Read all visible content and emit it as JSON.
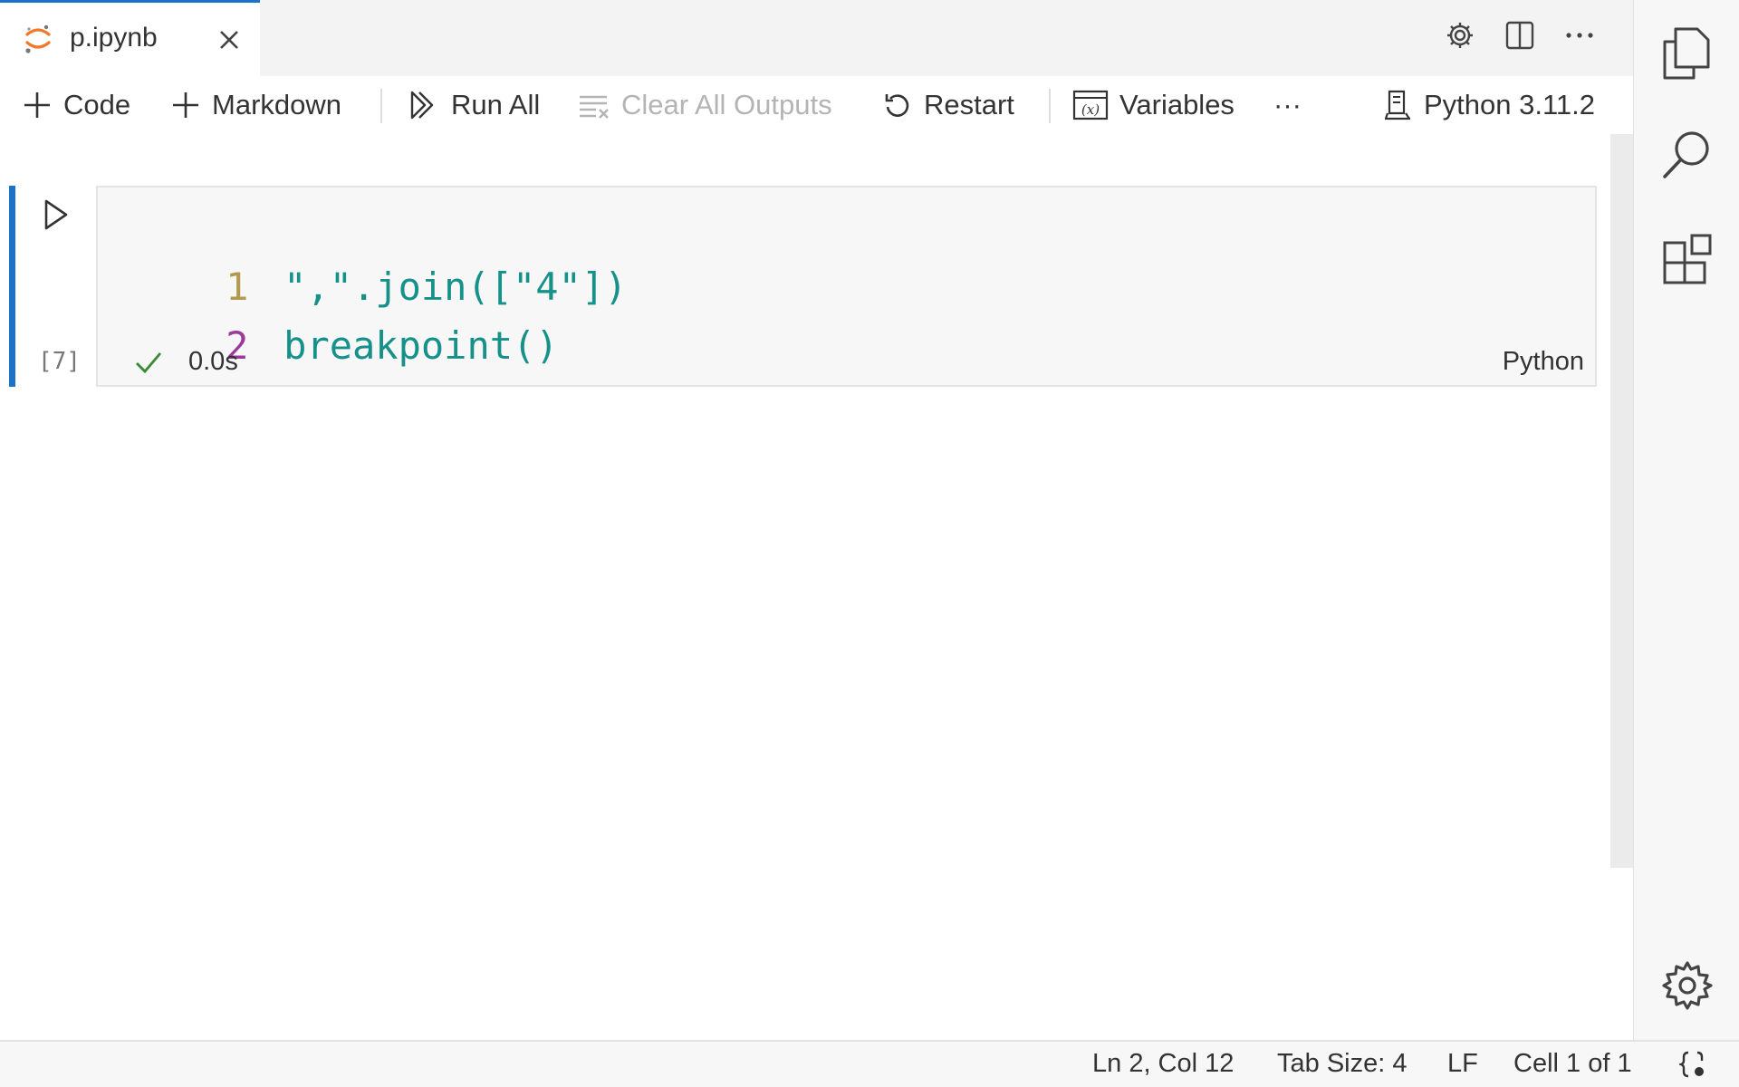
{
  "tab": {
    "title": "p.ipynb",
    "icon": "jupyter-icon"
  },
  "editor_actions": [
    {
      "name": "gear-icon"
    },
    {
      "name": "split-editor-icon"
    },
    {
      "name": "more-actions-icon"
    }
  ],
  "toolbar": {
    "code_label": "Code",
    "markdown_label": "Markdown",
    "run_all_label": "Run All",
    "clear_outputs_label": "Clear All Outputs",
    "restart_label": "Restart",
    "variables_label": "Variables",
    "more_label": "···",
    "kernel_label": "Python 3.11.2"
  },
  "cell": {
    "execution_count": "[7]",
    "lines": [
      {
        "number": "1",
        "code": "\",\".join([\"4\"])",
        "number_color": "#b39a4e"
      },
      {
        "number": "2",
        "code": "breakpoint()",
        "number_color": "#9b3a9b"
      }
    ],
    "code_color": "#16918a",
    "status": "success",
    "execution_time": "0.0s",
    "language": "Python"
  },
  "activity_bar": [
    {
      "name": "explorer-icon"
    },
    {
      "name": "search-icon"
    },
    {
      "name": "extensions-icon"
    },
    {
      "name": "manage-gear-icon"
    }
  ],
  "status_bar": {
    "position": "Ln 2, Col 12",
    "tab_size": "Tab Size: 4",
    "eol": "LF",
    "cell_info": "Cell 1 of 1"
  },
  "colors": {
    "accent": "#1a73c8",
    "jupyter_orange": "#f37726",
    "success_green": "#388a34"
  }
}
